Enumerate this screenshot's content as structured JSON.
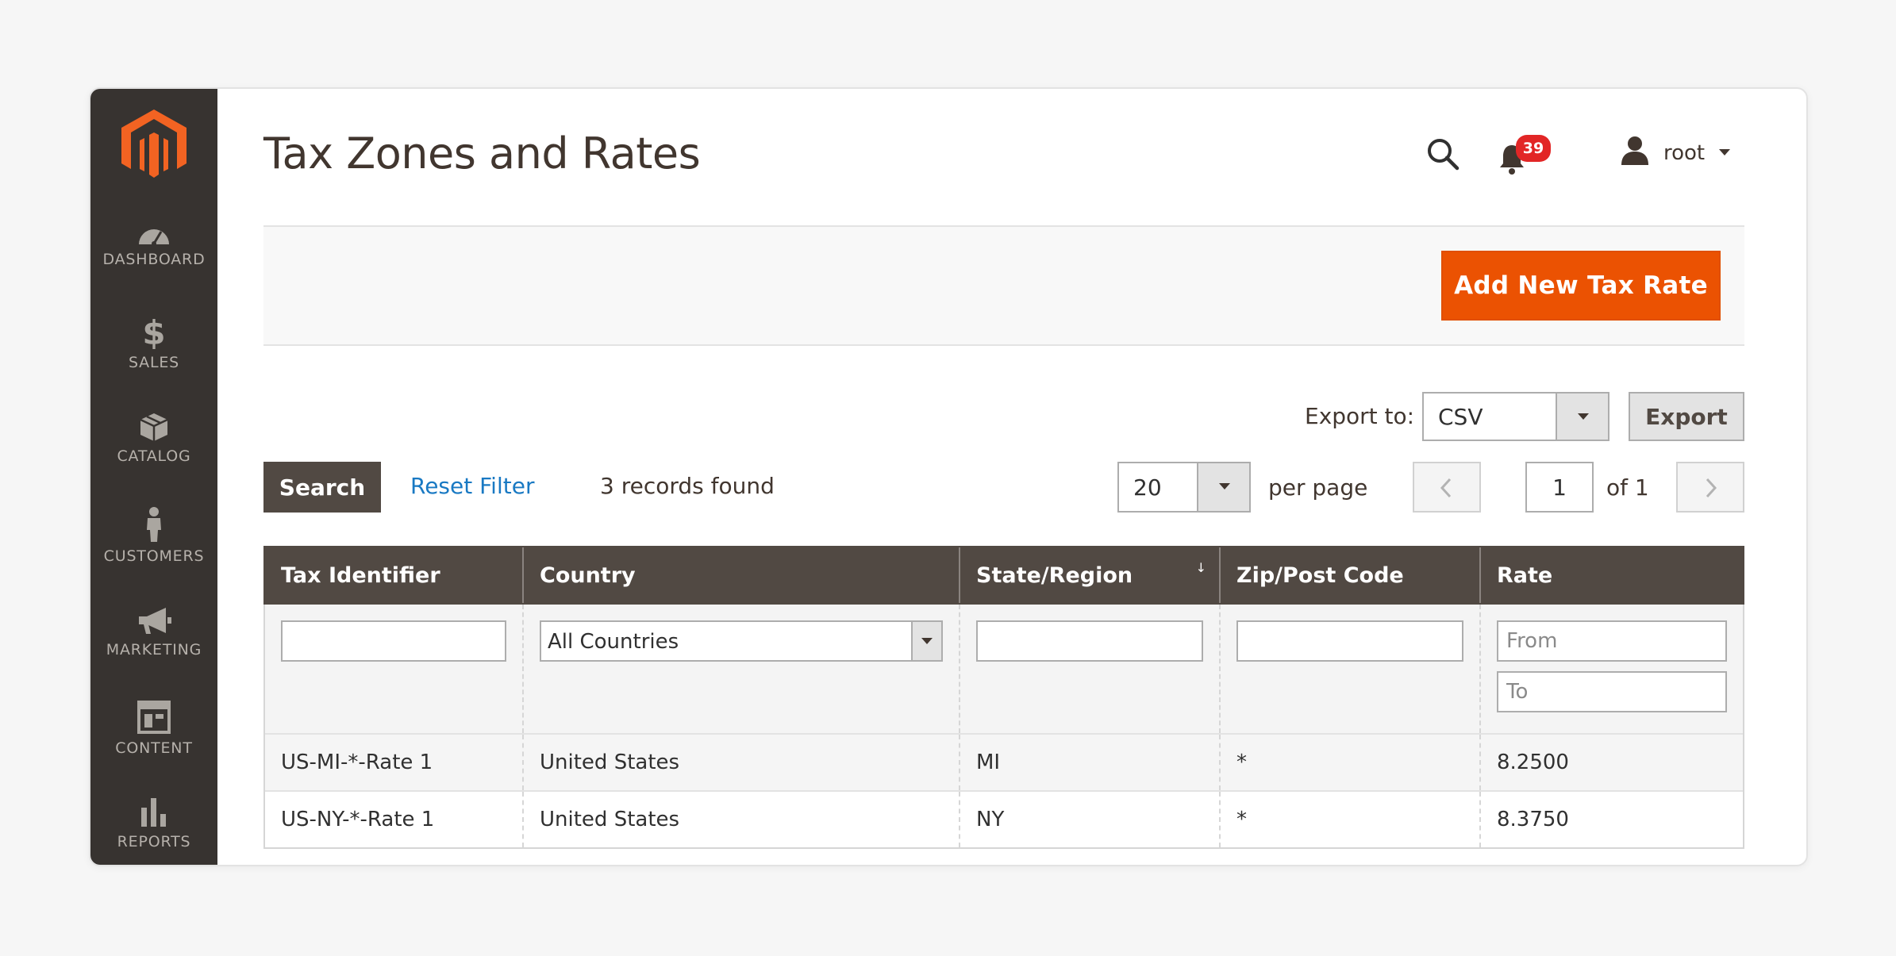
{
  "page": {
    "title": "Tax Zones and Rates"
  },
  "colors": {
    "sidebar": "#373330",
    "accent": "#eb5202",
    "header": "#514943",
    "link": "#1979c3",
    "badge": "#e22626"
  },
  "sidebar": {
    "items": [
      {
        "label": "DASHBOARD",
        "icon": "dashboard-icon"
      },
      {
        "label": "SALES",
        "icon": "dollar-icon"
      },
      {
        "label": "CATALOG",
        "icon": "box-icon"
      },
      {
        "label": "CUSTOMERS",
        "icon": "person-icon"
      },
      {
        "label": "MARKETING",
        "icon": "megaphone-icon"
      },
      {
        "label": "CONTENT",
        "icon": "layout-icon"
      },
      {
        "label": "REPORTS",
        "icon": "bar-chart-icon"
      }
    ]
  },
  "header": {
    "notifications_count": "39",
    "user_name": "root"
  },
  "actions": {
    "add_label": "Add New Tax Rate"
  },
  "export": {
    "label": "Export to:",
    "format": "CSV",
    "button": "Export"
  },
  "toolbar": {
    "search_label": "Search",
    "reset_label": "Reset Filter",
    "records_text": "3 records found",
    "per_page_value": "20",
    "per_page_label": "per page",
    "page_value": "1",
    "page_of": "of 1"
  },
  "grid": {
    "columns": [
      "Tax Identifier",
      "Country",
      "State/Region",
      "Zip/Post Code",
      "Rate"
    ],
    "sort_indicator": "↓",
    "filters": {
      "country_value": "All Countries",
      "rate_from_placeholder": "From",
      "rate_to_placeholder": "To"
    },
    "rows": [
      [
        "US-MI-*-Rate 1",
        "United States",
        "MI",
        "*",
        "8.2500"
      ],
      [
        "US-NY-*-Rate 1",
        "United States",
        "NY",
        "*",
        "8.3750"
      ]
    ]
  }
}
